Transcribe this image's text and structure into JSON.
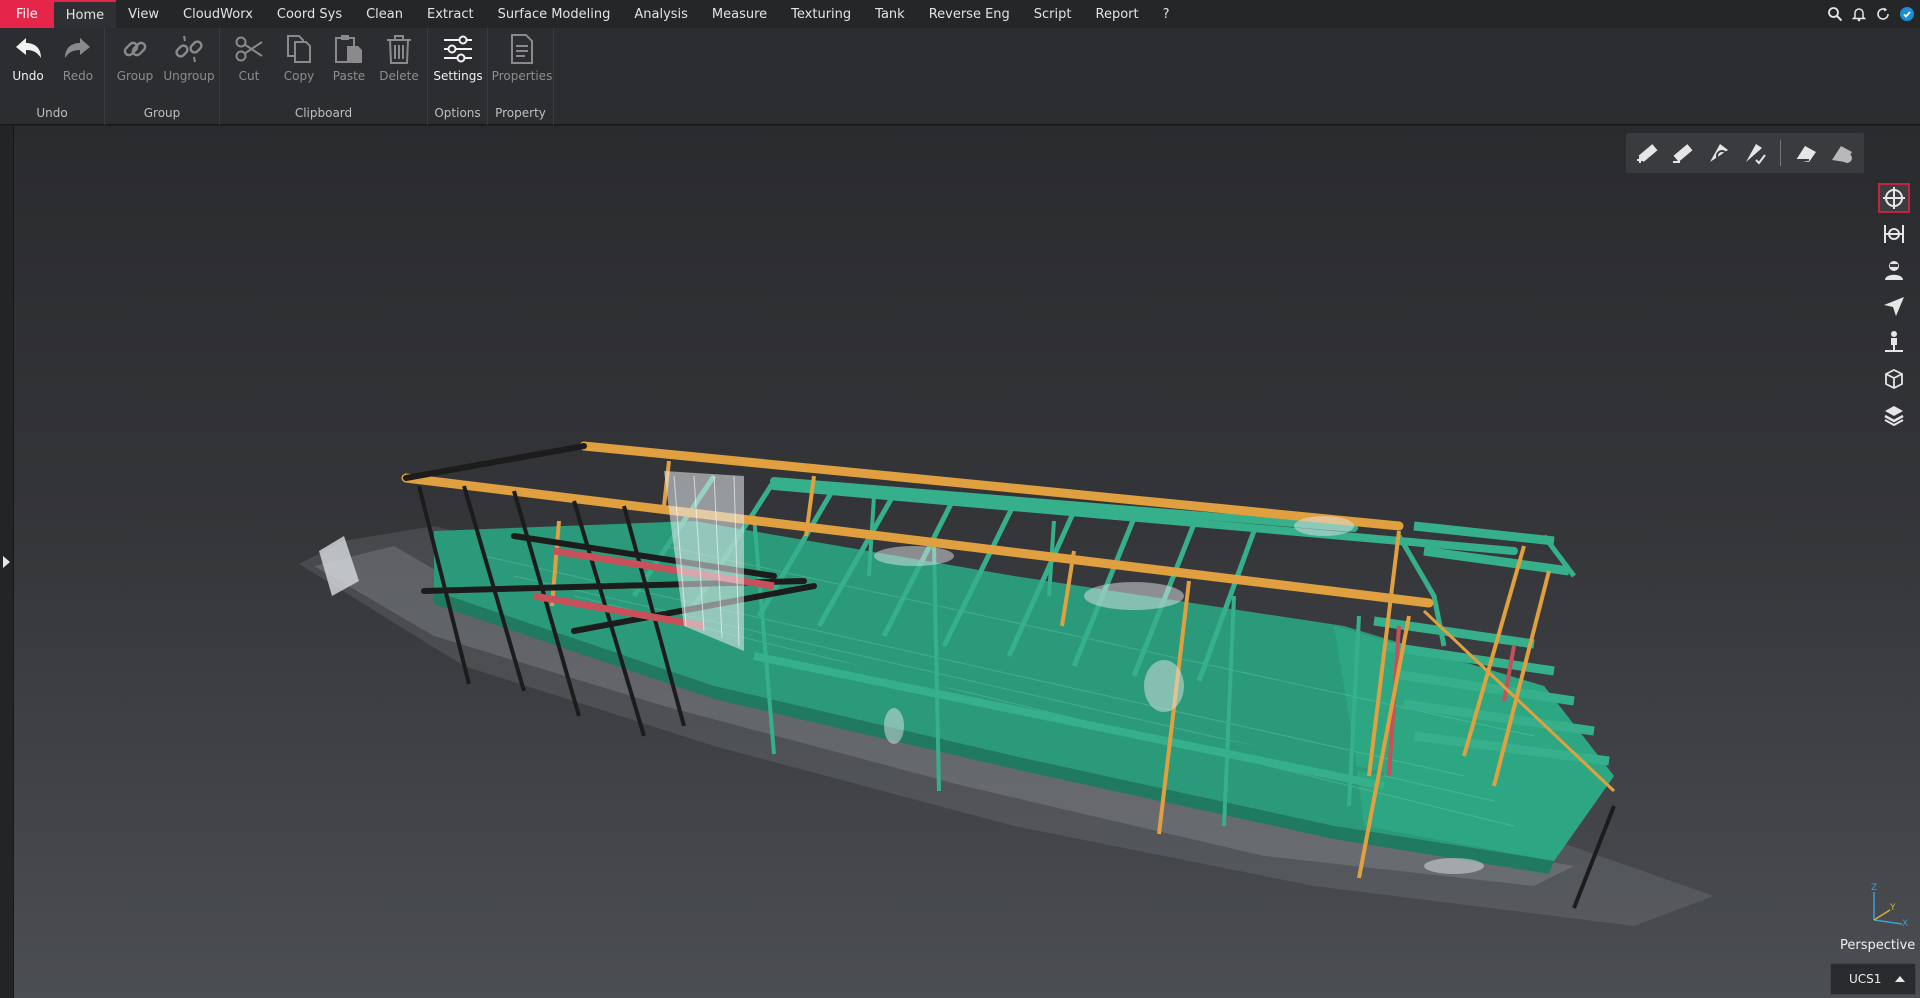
{
  "menu": {
    "file": "File",
    "items": [
      "Home",
      "View",
      "CloudWorx",
      "Coord Sys",
      "Clean",
      "Extract",
      "Surface Modeling",
      "Analysis",
      "Measure",
      "Texturing",
      "Tank",
      "Reverse Eng",
      "Script",
      "Report",
      "?"
    ],
    "active": "Home"
  },
  "ribbon": {
    "groups": {
      "undo": "Undo",
      "group": "Group",
      "clipboard": "Clipboard",
      "options": "Options",
      "property": "Property"
    },
    "buttons": {
      "undo": "Undo",
      "redo": "Redo",
      "group": "Group",
      "ungroup": "Ungroup",
      "cut": "Cut",
      "copy": "Copy",
      "paste": "Paste",
      "delete": "Delete",
      "settings": "Settings",
      "properties": "Properties"
    }
  },
  "viewport": {
    "projection": "Perspective",
    "ucs": "UCS1",
    "axis": {
      "z": "Z",
      "y": "Y",
      "x": "X"
    }
  },
  "colors": {
    "accent": "#e5264a",
    "floor": "#2a9a7a",
    "beam_orange": "#e0a040",
    "beam_teal": "#36b08a",
    "beam_black": "#1c1c1c",
    "beam_red": "#c8505a"
  }
}
